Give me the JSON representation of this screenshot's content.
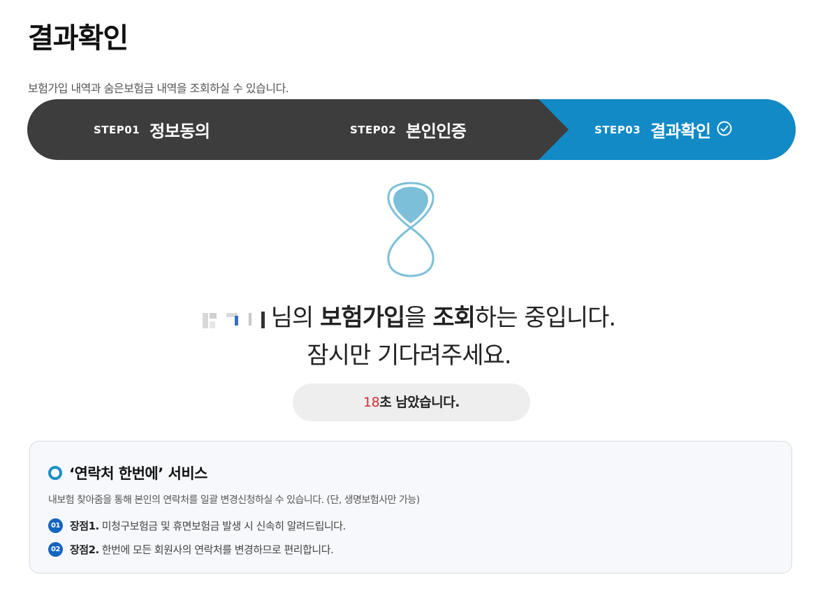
{
  "page": {
    "title": "결과확인",
    "description": "보험가입 내역과 숨은보험금 내역을 조회하실 수 있습니다."
  },
  "steps": [
    {
      "num": "STEP01",
      "label": "정보동의",
      "active": false
    },
    {
      "num": "STEP02",
      "label": "본인인증",
      "active": false
    },
    {
      "num": "STEP03",
      "label": "결과확인",
      "active": true
    }
  ],
  "colors": {
    "step_dark": "#3d3d3d",
    "step_active": "#118ac6",
    "accent_red": "#d32f2f",
    "badge_blue": "#1565c0",
    "hourglass_blue": "#7bbfd9"
  },
  "status": {
    "suffix_1": "님의 ",
    "bold_1": "보험가입",
    "mid_1": "을 ",
    "bold_2": "조회",
    "mid_2": "하는 중입니다.",
    "line_2": "잠시만 기다려주세요."
  },
  "countdown": {
    "seconds": "18",
    "text": "초 남았습니다."
  },
  "service": {
    "title": "‘연락처 한번에’ 서비스",
    "description": "내보험 찾아줌을 통해 본인의 연락처를 일괄 변경신청하실 수 있습니다. (단, 생명보험사만 가능)",
    "benefits": [
      {
        "no": "01",
        "name": "장점1.",
        "text": "미청구보험금 및 휴면보험금 발생 시 신속히 알려드립니다."
      },
      {
        "no": "02",
        "name": "장점2.",
        "text": "한번에 모든 회원사의 연락처를 변경하므로 편리합니다."
      }
    ]
  }
}
